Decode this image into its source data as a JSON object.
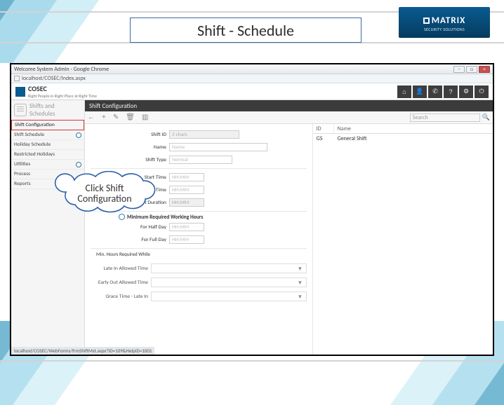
{
  "page_title": "Shift - Schedule",
  "logo": {
    "brand": "MATRIX",
    "sub": "SECURITY SOLUTIONS"
  },
  "chrome": {
    "title": "Welcome System Admin - Google Chrome",
    "url": "localhost/COSEC/Index.aspx"
  },
  "app": {
    "name": "COSEC",
    "tagline": "Right People in Right Place at Right Time",
    "icons": [
      "home",
      "user",
      "phone",
      "help",
      "settings",
      "power"
    ]
  },
  "sidebar": {
    "heading": "Shifts and Schedules",
    "items": [
      {
        "label": "Shift Configuration",
        "selected": true
      },
      {
        "label": "Shift Schedule",
        "dot": true
      },
      {
        "label": "Holiday Schedule"
      },
      {
        "label": "Restricted Holidays"
      },
      {
        "label": "Utilities",
        "dot": true
      },
      {
        "label": "Process"
      },
      {
        "label": "Reports"
      }
    ]
  },
  "content": {
    "title": "Shift Configuration",
    "search_placeholder": "Search"
  },
  "form": {
    "shift_id_label": "Shift ID",
    "shift_id_value": "2 chars",
    "name_label": "Name",
    "name_value": "Name",
    "shift_type_label": "Shift Type",
    "shift_type_value": "Normal",
    "start_time_label": "Start Time",
    "start_time_value": "HH:MM",
    "end_time_label": "End Time",
    "end_time_value": "HH:MM",
    "shift_duration_label": "Shift Duration",
    "shift_duration_value": "HH:MM",
    "sub_heading": "Minimum Required Working Hours",
    "half_day_label": "For Half Day",
    "half_day_value": "HH:MM",
    "full_day_label": "For Full Day",
    "full_day_value": "HH:MM",
    "min_hours_label": "Min. Hours Required While",
    "drop_rows": [
      {
        "cap": "Late In Allowed Time"
      },
      {
        "cap": "Early Out Allowed Time"
      },
      {
        "cap": "Grace Time - Late In"
      }
    ]
  },
  "list": {
    "h1": "ID",
    "h2": "Name",
    "rows": [
      {
        "id": "GS",
        "name": "General Shift"
      }
    ]
  },
  "callout": {
    "line1": "Click Shift",
    "line2": "Configuration"
  },
  "status_text": "localhost/COSEC/WebForms/frmShiftMst.aspx?ID=109&HelpID=1001"
}
